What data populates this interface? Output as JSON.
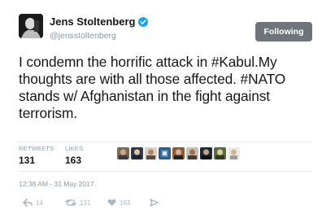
{
  "user": {
    "display_name": "Jens Stoltenberg",
    "handle": "@jensstoltenberg",
    "verified_icon": "verified-badge-icon",
    "avatar_icon": "avatar-photo"
  },
  "follow_button": {
    "label": "Following"
  },
  "tweet_text": "I condemn the horrific attack in #Kabul.My thoughts are with all those affected. #NATO stands w/ Afghanistan in the fight against terrorism.",
  "stats": {
    "retweets_label": "RETWEETS",
    "retweets_value": "131",
    "likes_label": "LIKES",
    "likes_value": "163"
  },
  "likers_count": 9,
  "timestamp": "12:38 AM - 31 May 2017",
  "actions": {
    "reply_count": "14",
    "retweet_count": "131",
    "like_count": "163",
    "reply_icon": "reply-icon",
    "retweet_icon": "retweet-icon",
    "like_icon": "heart-icon",
    "dm_icon": "direct-message-icon"
  },
  "colors": {
    "text": "#14171a",
    "muted": "#8899a6",
    "action_icon": "#aab8c2",
    "follow_button_bg": "#6e7479",
    "verified": "#1da1f2",
    "divider": "#e6ecf0"
  }
}
